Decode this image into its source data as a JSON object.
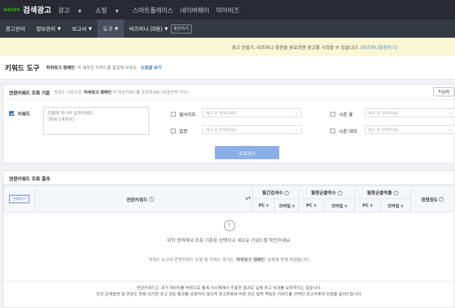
{
  "top": {
    "naver": "NAVER",
    "brand": "검색광고",
    "menu": [
      "광고",
      "쇼핑",
      "스마트플레이스",
      "네이버페이",
      "마이비즈"
    ]
  },
  "nav": {
    "items": [
      "광고관리",
      "정보관리",
      "보고서",
      "도구",
      "비즈머니 (0원)"
    ],
    "charge": "충전하기"
  },
  "notice": {
    "text": "광고 만들기, 비즈머니 충전을 완료하면 광고를 시작할 수 있습니다.",
    "link": "[비즈머니충전하기]"
  },
  "title": {
    "heading": "키워드 도구",
    "desc_prefix": "'",
    "campaign": "파워링크 캠페인",
    "desc_suffix": "' 의 새로운 키워드를 발굴해 보세요.",
    "help": "도움말 보기"
  },
  "query": {
    "heading": "연관키워드 조회 기준",
    "sub_prefix": "원하는 기준으로 '",
    "sub_campaign": "파워링크 캠페인",
    "sub_suffix": "'의 연관키워드를 조회하세요.(다중선택 가능)",
    "input_toggle": "입력",
    "keyword_label": "키워드",
    "keyword_placeholder_1": "한줄에 하나씩 입력하세요.",
    "keyword_placeholder_2": "(최대 5개까지)",
    "website_label": "웹사이트",
    "industry_label": "업종",
    "season_month_label": "시즌 월",
    "season_theme_label": "시즌 테마",
    "select_placeholder": "체크 후 선택하세요",
    "search_button": "조회하기"
  },
  "results": {
    "heading": "연관키워드 조회 결과",
    "add_all": "전체추가",
    "col_keyword": "연관키워드",
    "col_monthly_search": "월간검색수",
    "col_monthly_clicks": "월평균클릭수",
    "col_monthly_ctr": "월평균클릭률",
    "col_competition": "경쟁정도",
    "pc": "PC",
    "mobile": "모바일",
    "empty_1": "위의 영역에서 조회 기준을 선택하고 새로운 키워드를 확인하세요.",
    "empty_2_prefix": "키워드 도구의 연관키워드 조회 및 키워드 추가는 '",
    "empty_2_campaign": "파워링크 캠페인",
    "empty_2_suffix": "' 유형에 한해 지원됩니다.",
    "foot_1": "연관키워드는 과거 데이터를 바탕으로 통계 시스템에서 추출한 결과로 실제 광고 성과를 보장하지는 않습니다.",
    "foot_2": "또한 관계법령 및 연관도 등에 의거한 광고 검토 통과를 보장하지 않으며 광고등록에 따른 모든 법적 책임은 키워드를 선택한 광고주에게 있음을 알려드립니다."
  },
  "colors": {
    "naver_green": "#2db400",
    "header_dark": "#272a33",
    "nav_dark": "#353943",
    "accent_blue": "#3b6fd1",
    "notice_bg": "#fbf6d3",
    "button_blue": "#8aaee6"
  }
}
